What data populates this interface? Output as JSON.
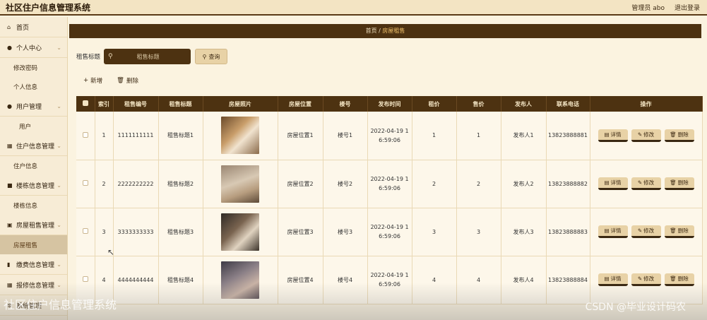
{
  "app": {
    "title": "社区住户信息管理系统",
    "user": "管理员 abo",
    "logout": "退出登录"
  },
  "sidebar": {
    "home": "首页",
    "groups": [
      {
        "label": "个人中心",
        "icon": "user-icon",
        "items": [
          "修改密码",
          "个人信息"
        ]
      },
      {
        "label": "用户管理",
        "icon": "user-icon",
        "items": [
          "用户"
        ]
      },
      {
        "label": "住户信息管理",
        "icon": "grid-icon",
        "items": [
          "住户信息"
        ]
      },
      {
        "label": "楼栋信息管理",
        "icon": "building-icon",
        "items": [
          "楼栋信息"
        ]
      },
      {
        "label": "房屋租售管理",
        "icon": "lock-icon",
        "items": [
          "房屋租售"
        ]
      },
      {
        "label": "缴费信息管理",
        "icon": "chart-icon",
        "items": []
      },
      {
        "label": "报修信息管理",
        "icon": "grid-icon",
        "items": []
      },
      {
        "label": "系统管理",
        "icon": "gear-icon",
        "items": []
      }
    ]
  },
  "breadcrumb": {
    "home": "首页",
    "sep": "/",
    "current": "房屋租售"
  },
  "search": {
    "label": "租售标题",
    "placeholder": "租售标题",
    "button": "查询"
  },
  "actions": {
    "add": "新增",
    "delete": "删除"
  },
  "table": {
    "columns": [
      "索引",
      "租售编号",
      "租售标题",
      "房屋照片",
      "房屋位置",
      "楼号",
      "发布时间",
      "租价",
      "售价",
      "发布人",
      "联系电话",
      "操作"
    ],
    "op_labels": {
      "detail": "详情",
      "edit": "修改",
      "delete": "删除"
    },
    "rows": [
      {
        "index": "1",
        "code": "1111111111",
        "title": "租售标题1",
        "location": "房屋位置1",
        "building": "楼号1",
        "time1": "2022-04-19 1",
        "time2": "6:59:06",
        "rent": "1",
        "sale": "1",
        "publisher": "发布人1",
        "phone": "13823888881"
      },
      {
        "index": "2",
        "code": "2222222222",
        "title": "租售标题2",
        "location": "房屋位置2",
        "building": "楼号2",
        "time1": "2022-04-19 1",
        "time2": "6:59:06",
        "rent": "2",
        "sale": "2",
        "publisher": "发布人2",
        "phone": "13823888882"
      },
      {
        "index": "3",
        "code": "3333333333",
        "title": "租售标题3",
        "location": "房屋位置3",
        "building": "楼号3",
        "time1": "2022-04-19 1",
        "time2": "6:59:06",
        "rent": "3",
        "sale": "3",
        "publisher": "发布人3",
        "phone": "13823888883"
      },
      {
        "index": "4",
        "code": "4444444444",
        "title": "租售标题4",
        "location": "房屋位置4",
        "building": "楼号4",
        "time1": "2022-04-19 1",
        "time2": "6:59:06",
        "rent": "4",
        "sale": "4",
        "publisher": "发布人4",
        "phone": "13823888884"
      }
    ]
  },
  "watermark": {
    "left": "社区住户信息管理系统",
    "right": "CSDN @毕业设计码农"
  },
  "colors": {
    "dark": "#4d3211",
    "accent": "#f2c36b",
    "button": "#e8d2a6",
    "background": "#fbf3e0"
  }
}
